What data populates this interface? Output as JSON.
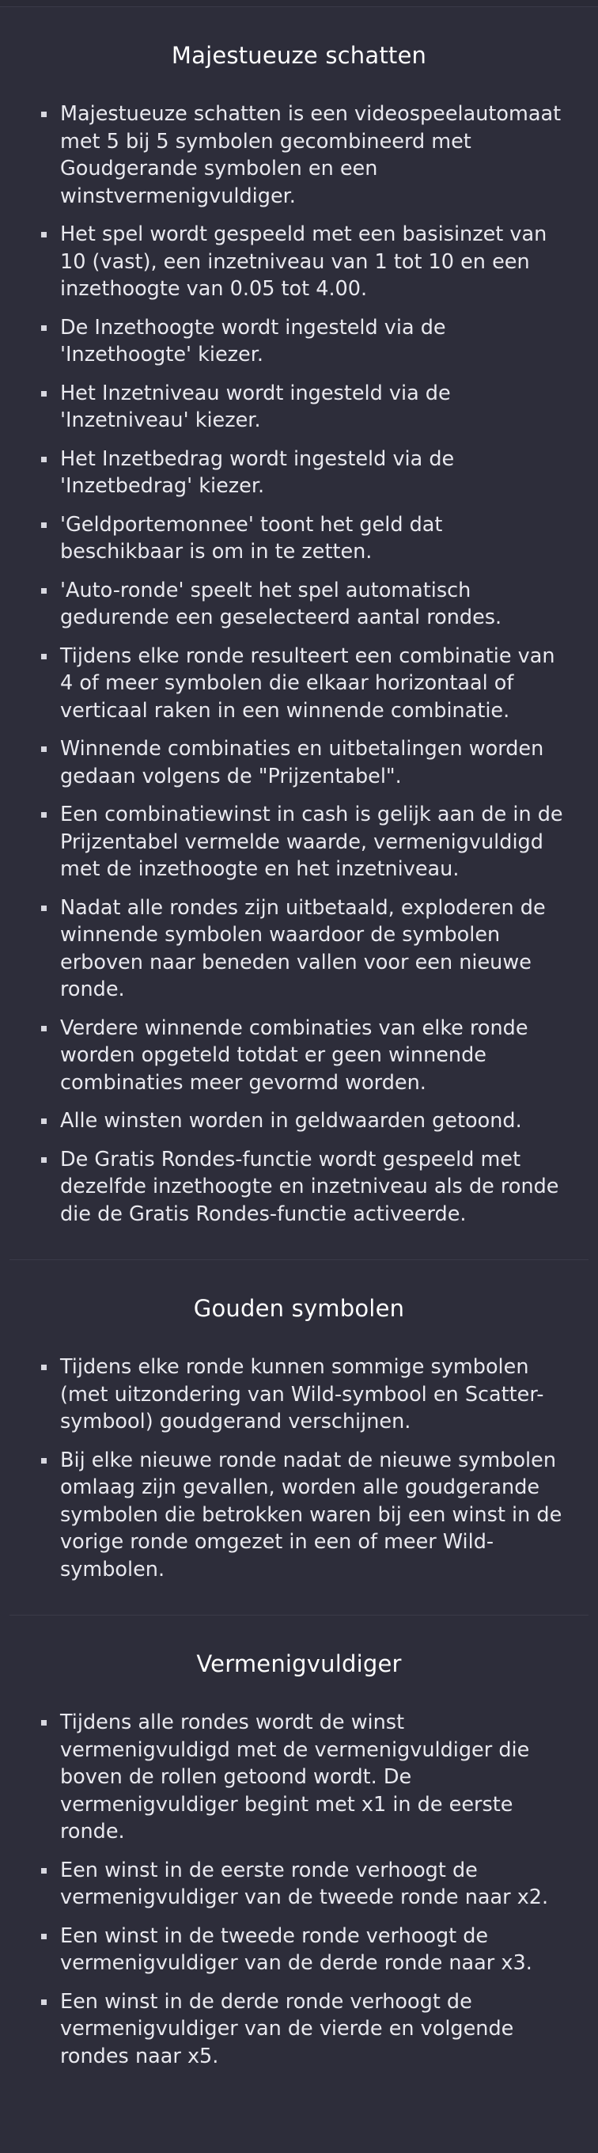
{
  "sections": [
    {
      "title": "Majestueuze schatten",
      "items": [
        "Majestueuze schatten is een videospeelautomaat met 5 bij 5 symbolen gecombineerd met Goudgerande symbolen en een winstvermenigvuldiger.",
        "Het spel wordt gespeeld met een basisinzet van 10 (vast), een inzetniveau van 1 tot 10 en een inzethoogte van 0.05 tot 4.00.",
        "De Inzethoogte wordt ingesteld via de 'Inzethoogte' kiezer.",
        "Het Inzetniveau wordt ingesteld via de 'Inzetniveau' kiezer.",
        "Het Inzetbedrag wordt ingesteld via de 'Inzetbedrag' kiezer.",
        "'Geldportemonnee' toont het geld dat beschikbaar is om in te zetten.",
        "'Auto-ronde' speelt het spel automatisch gedurende een geselecteerd aantal rondes.",
        "Tijdens elke ronde resulteert een combinatie van 4 of meer symbolen die elkaar horizontaal of verticaal raken in een winnende combinatie.",
        "Winnende combinaties en uitbetalingen worden gedaan volgens de \"Prijzentabel\".",
        "Een combinatiewinst in cash is gelijk aan de in de Prijzentabel vermelde waarde, vermenigvuldigd met de inzethoogte en het inzetniveau.",
        "Nadat alle rondes zijn uitbetaald, exploderen de winnende symbolen waardoor de symbolen erboven naar beneden vallen voor een nieuwe ronde.",
        "Verdere winnende combinaties van elke ronde worden opgeteld totdat er geen winnende combinaties meer gevormd worden.",
        "Alle winsten worden in geldwaarden getoond.",
        "De Gratis Rondes-functie wordt gespeeld met dezelfde inzethoogte en inzetniveau als de ronde die de Gratis Rondes-functie activeerde."
      ]
    },
    {
      "title": "Gouden symbolen",
      "items": [
        "Tijdens elke ronde kunnen sommige symbolen (met uitzondering van Wild-symbool en Scatter-symbool) goudgerand verschijnen.",
        "Bij elke nieuwe ronde nadat de nieuwe symbolen omlaag zijn gevallen, worden alle goudgerande symbolen die betrokken waren bij een winst in de vorige ronde omgezet in een of meer Wild-symbolen."
      ]
    },
    {
      "title": "Vermenigvuldiger",
      "items": [
        "Tijdens alle rondes wordt de winst vermenigvuldigd met de vermenigvuldiger die boven de rollen getoond wordt. De vermenigvuldiger begint met x1 in de eerste ronde.",
        "Een winst in de eerste ronde verhoogt de vermenigvuldiger van de tweede ronde naar x2.",
        "Een winst in de tweede ronde verhoogt de vermenigvuldiger van de derde ronde naar x3.",
        "Een winst in de derde ronde verhoogt de vermenigvuldiger van de vierde en volgende rondes naar x5."
      ]
    }
  ]
}
